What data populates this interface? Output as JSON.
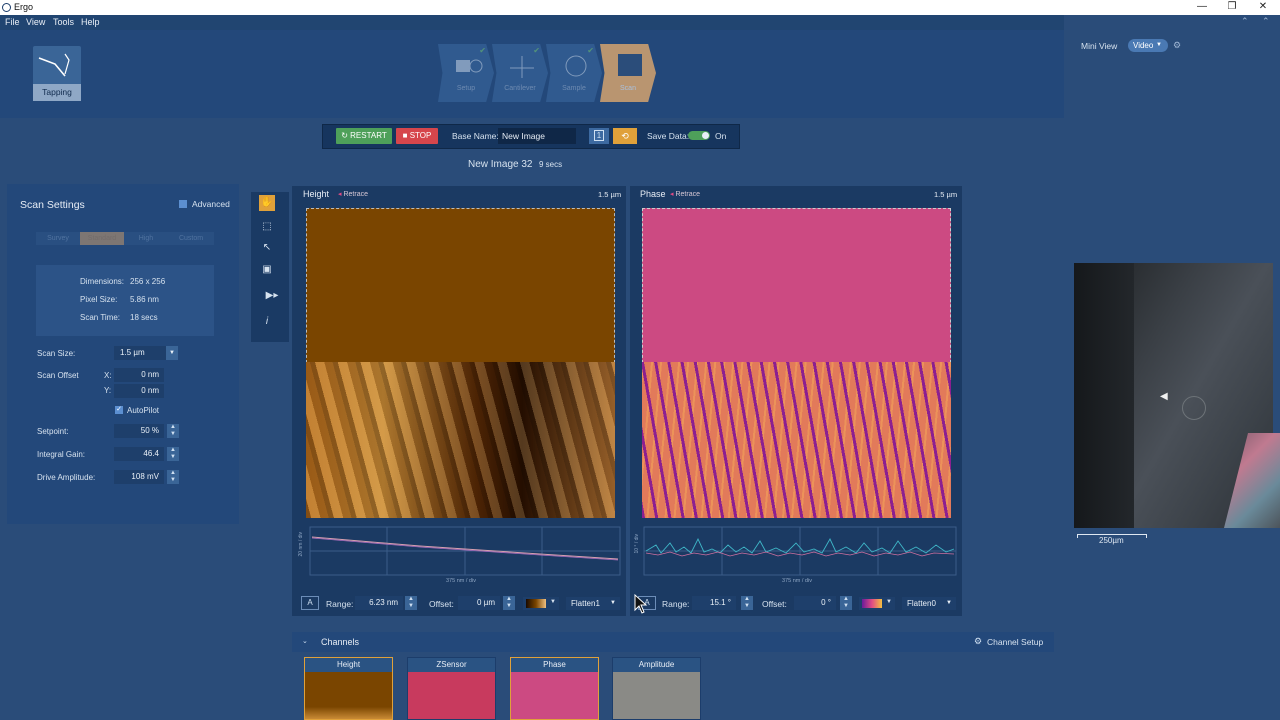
{
  "app": {
    "title": "Ergo",
    "window_controls": [
      "—",
      "❐",
      "✕"
    ]
  },
  "menu": [
    "File",
    "View",
    "Tools",
    "Help"
  ],
  "mode": {
    "label": "Tapping"
  },
  "workflow": [
    {
      "label": "Setup"
    },
    {
      "label": "Cantilever"
    },
    {
      "label": "Sample"
    },
    {
      "label": "Scan"
    }
  ],
  "control": {
    "restart": "RESTART",
    "stop": "STOP",
    "base_name_label": "Base Name:",
    "base_name": "New Image",
    "save_label": "Save Data:",
    "save_state": "On",
    "image_status": "New Image 32",
    "elapsed": "9 secs",
    "counter": "1"
  },
  "scan_settings": {
    "title": "Scan Settings",
    "advanced": "Advanced",
    "presets": [
      "Survey",
      "Standard",
      "High",
      "Custom"
    ],
    "dimensions_label": "Dimensions:",
    "dimensions": "256 x 256",
    "pixel_label": "Pixel Size:",
    "pixel": "5.86 nm",
    "time_label": "Scan Time:",
    "time": "18 secs",
    "size_label": "Scan Size:",
    "size": "1.5 µm",
    "offset_label": "Scan Offset",
    "x_label": "X:",
    "x": "0 nm",
    "y_label": "Y:",
    "y": "0 nm",
    "autopilot": "AutoPilot",
    "setpoint_label": "Setpoint:",
    "setpoint": "50 %",
    "gain_label": "Integral Gain:",
    "gain": "46.4",
    "drive_label": "Drive Amplitude:",
    "drive": "108 mV"
  },
  "height_panel": {
    "title": "Height",
    "retrace": "Retrace",
    "size": "1.5 µm",
    "ylabel": "20 nm / div",
    "xlabel": "375 nm / div",
    "range_label": "Range:",
    "range": "6.23 nm",
    "offset_label": "Offset:",
    "offset": "0 µm",
    "flatten": "Flatten1",
    "auto": "A"
  },
  "phase_panel": {
    "title": "Phase",
    "retrace": "Retrace",
    "size": "1.5 µm",
    "ylabel": "10 ° / div",
    "xlabel": "375 nm / div",
    "range_label": "Range:",
    "range": "15.1 °",
    "offset_label": "Offset:",
    "offset": "0 °",
    "flatten": "Flatten0",
    "auto": "A"
  },
  "channels": {
    "title": "Channels",
    "setup": "Channel Setup",
    "items": [
      "Height",
      "ZSensor",
      "Phase",
      "Amplitude"
    ]
  },
  "miniview": {
    "title": "Mini View",
    "source": "Video",
    "scale": "250µm"
  },
  "colors": {
    "accent_green": "#4ea05a",
    "stop_red": "#d6464c",
    "height_brown": "#7a4500",
    "phase_pink": "#cc4a82"
  }
}
